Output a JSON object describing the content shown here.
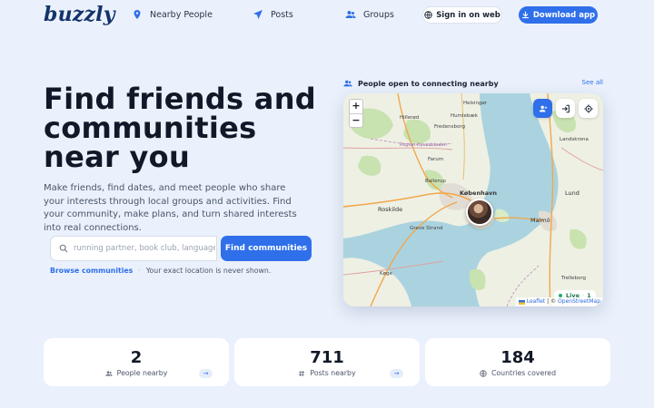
{
  "brand": {
    "name": "buzzly",
    "accent": "#2f6fea"
  },
  "nav": {
    "items": [
      {
        "label": "Nearby People",
        "icon": "map-pin-icon"
      },
      {
        "label": "Posts",
        "icon": "send-icon"
      },
      {
        "label": "Groups",
        "icon": "users-icon"
      }
    ],
    "sign_in_label": "Sign in on web",
    "download_label": "Download app"
  },
  "hero": {
    "title": "Find friends and communities near you",
    "description": "Make friends, find dates, and meet people who share your interests through local groups and activities. Find your community, make plans, and turn shared interests into real connections.",
    "search_placeholder": "running partner, book club, language exchange",
    "find_label": "Find communities",
    "browse_label": "Browse communities",
    "separator": "·",
    "privacy_note": "Your exact location is never shown."
  },
  "map_panel": {
    "title": "People open to connecting nearby",
    "see_all": "See all",
    "zoom_in": "+",
    "zoom_out": "−",
    "live_label": "Live",
    "live_sep": "·",
    "live_count": "1",
    "attribution_leaflet": "Leaflet",
    "attribution_sep": "| ©",
    "attribution_osm": "OpenStreetMap",
    "places": {
      "helsingor": "Helsingør",
      "humlebaek": "Humlebæk",
      "fredensborg": "Fredensborg",
      "hillerod": "Hillerød",
      "landskrona": "Landskrona",
      "farum": "Farum",
      "ballerup": "Ballerup",
      "kobenhavn": "København",
      "lund": "Lund",
      "roskilde": "Roskilde",
      "greve": "Greve Strand",
      "malmo": "Malmö",
      "trelleborg": "Trelleborg",
      "koge": "Køge",
      "region": "Region Hovedstaden"
    }
  },
  "stats": [
    {
      "value": "2",
      "label": "People nearby",
      "icon": "users-icon",
      "has_arrow": true
    },
    {
      "value": "711",
      "label": "Posts nearby",
      "icon": "hash-icon",
      "has_arrow": true
    },
    {
      "value": "184",
      "label": "Countries covered",
      "icon": "globe-icon",
      "has_arrow": false
    }
  ],
  "arrow_glyph": "→"
}
